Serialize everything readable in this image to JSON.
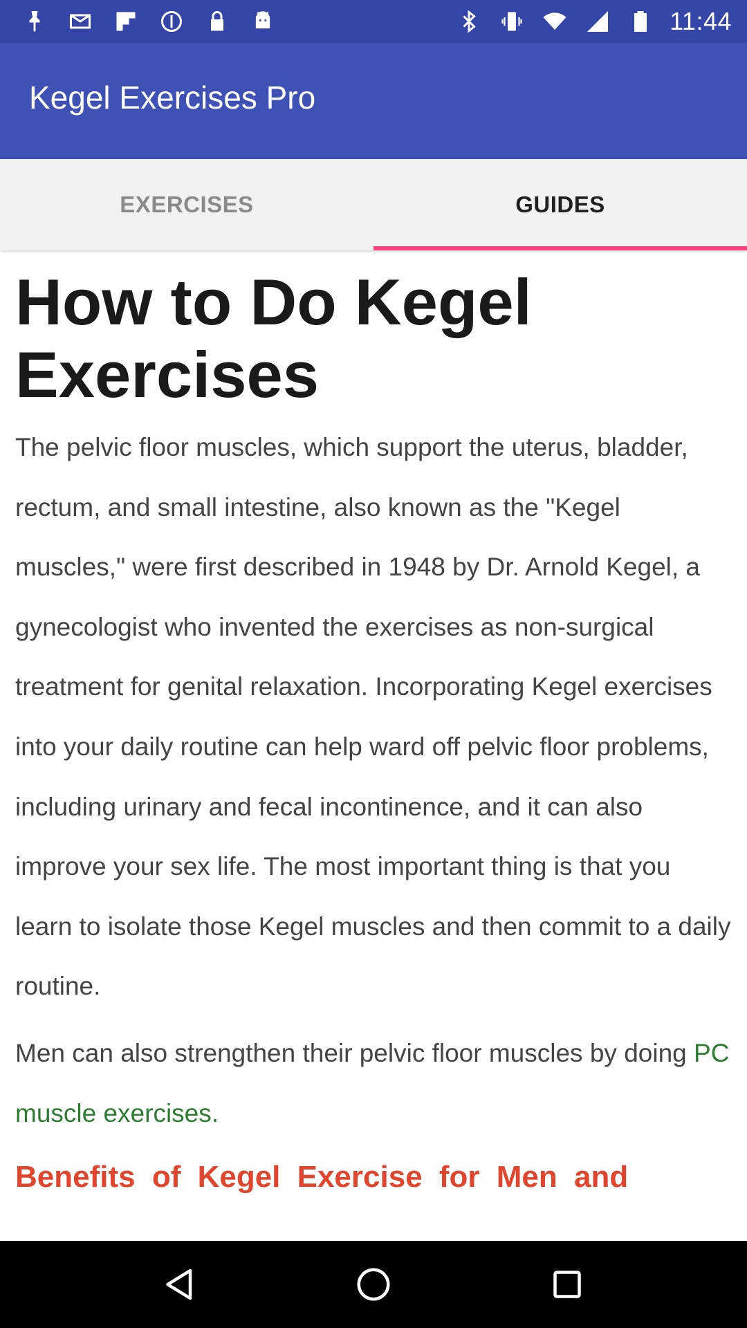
{
  "status_bar": {
    "time": "11:44",
    "left_icons": [
      "notification-pin-icon",
      "mail-icon",
      "flipboard-icon",
      "info-circle-icon",
      "lock-icon",
      "android-icon"
    ],
    "right_icons": [
      "bluetooth-icon",
      "vibrate-icon",
      "wifi-icon",
      "signal-icon",
      "battery-icon"
    ]
  },
  "app_bar": {
    "title": "Kegel Exercises Pro"
  },
  "tabs": [
    {
      "label": "EXERCISES",
      "selected": false
    },
    {
      "label": "GUIDES",
      "selected": true
    }
  ],
  "guide": {
    "title": "How to Do Kegel Exercises",
    "paragraph1": "The pelvic floor muscles, which support the uterus, bladder, rectum, and small intestine, also known as the \"Kegel muscles,\" were first described in 1948 by Dr. Arnold Kegel, a gynecologist who invented the exercises as non-surgical treatment for genital relaxation. Incorporating Kegel exercises into your daily routine can help ward off pelvic floor problems, including urinary and fecal incontinence, and it can also improve your sex life. The most important thing is that you learn to isolate those Kegel muscles and then commit to a daily routine.",
    "paragraph2_prefix": "Men can also strengthen their pelvic floor muscles by doing ",
    "paragraph2_link": "PC muscle exercises",
    "paragraph2_suffix": ".",
    "next_heading": "Benefits of Kegel Exercise for Men and"
  },
  "colors": {
    "status_bar": "#3646a8",
    "app_bar": "#3f51b5",
    "tab_indicator": "#ff4081",
    "link": "#2e7d32",
    "heading_accent": "#e0452e"
  },
  "nav_bar": {
    "buttons": [
      "back-icon",
      "home-icon",
      "recents-icon"
    ]
  }
}
